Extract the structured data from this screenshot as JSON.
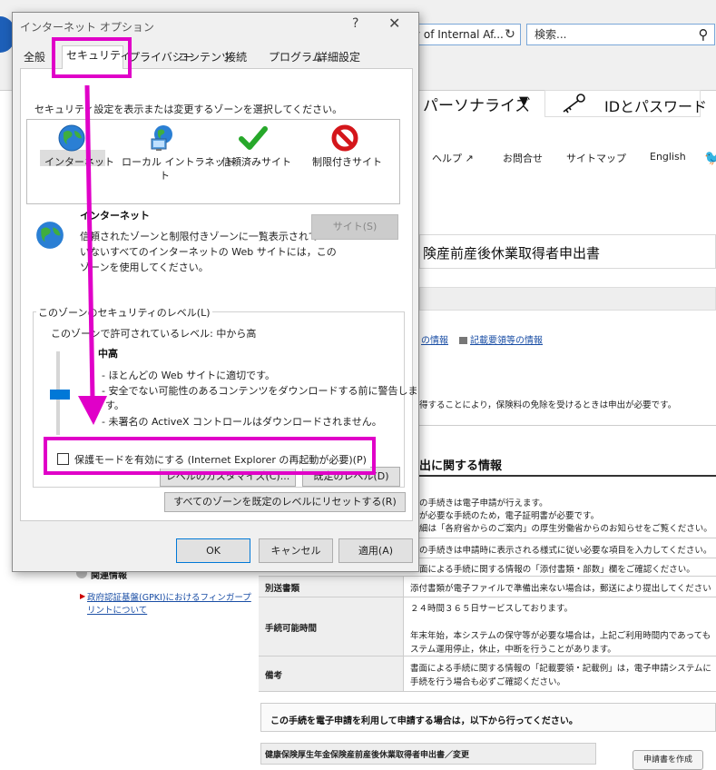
{
  "browser": {
    "address_text": "ry of Internal Af...",
    "search_placeholder": "検索...",
    "refresh_glyph": "↻",
    "search_glyph": "⚲"
  },
  "site": {
    "personalize": "パーソナライズ",
    "id_password": "IDとパスワード",
    "nav": [
      "ヘルプ",
      "お問合せ",
      "サイトマップ",
      "English"
    ],
    "page_title": "険産前産後休業取得者申出書",
    "links": [
      "の情報",
      "記載要領等の情報"
    ],
    "note1": "得することにより，保険料の免除を受けるときは申出が必要です。",
    "section_title": "出に関する情報",
    "info_lines": [
      "の手続きは電子申請が行えます。",
      "が必要な手続のため，電子証明書が必要です。",
      "細は「各府省からのご案内」の厚生労働省からのお知らせをご覧ください。",
      "の手続きは申請時に表示される様式に従い必要な項目を入力してください。",
      "面による手続に関する情報の「添付書類・部数」欄をご確認ください。"
    ],
    "table": [
      {
        "label": "別送書類",
        "value": [
          "添付書類が電子ファイルで準備出来ない場合は，郵送により提出してください"
        ]
      },
      {
        "label": "手続可能時間",
        "value": [
          "２４時間３６５日サービスしております。",
          "",
          "年末年始，本システムの保守等が必要な場合は，上記ご利用時間内であっても",
          "ステム運用停止，休止，中断を行うことがあります。"
        ]
      },
      {
        "label": "備考",
        "value": [
          "書面による手続に関する情報の「記載要領・記載例」は，電子申請システムに",
          "手続を行う場合も必ずご確認ください。"
        ]
      }
    ],
    "related_head": "関連情報",
    "related_links": [
      "政府認証基盤(GPKI)におけるフィンガープ",
      "リントについて"
    ],
    "apply_text": "この手続を電子申請を利用して申請する場合は，以下から行ってください。",
    "form_row_label": "健康保険厚生年金保険産前産後休業取得者申出書／変更",
    "create_button": "申請書を作成"
  },
  "dialog": {
    "title": "インターネット オプション",
    "help": "?",
    "close": "✕",
    "tabs": [
      "全般",
      "セキュリティ",
      "プライバシー",
      "コンテンツ",
      "接続",
      "プログラム",
      "詳細設定"
    ],
    "active_tab": "セキュリティ",
    "instruction": "セキュリティ設定を表示または変更するゾーンを選択してください。",
    "zones": [
      {
        "label": "インターネット",
        "icon": "globe-icon"
      },
      {
        "label": "ローカル イントラネット",
        "icon": "intranet-icon"
      },
      {
        "label": "信頼済みサイト",
        "icon": "checkmark-icon"
      },
      {
        "label": "制限付きサイト",
        "icon": "prohibited-icon"
      }
    ],
    "zone_label_wrap": "ト",
    "selected_zone_name": "インターネット",
    "zone_description": [
      "信頼されたゾーンと制限付きゾーンに一覧表示されて",
      "いないすべてのインターネットの Web サイトには，この",
      "ゾーンを使用してください。"
    ],
    "sites_button": "サイト(S)",
    "level_group_label": "このゾーンのセキュリティのレベル(L)",
    "allowed_levels": "このゾーンで許可されているレベル: 中から高",
    "level_name": "中高",
    "level_description": [
      "- ほとんどの Web サイトに適切です。",
      "- 安全でない可能性のあるコンテンツをダウンロードする前に警告しま",
      "す。",
      "- 未署名の ActiveX コントロールはダウンロードされません。"
    ],
    "protected_mode_label": "保護モードを有効にする (Internet Explorer の再起動が必要)(P)",
    "protected_mode_checked": false,
    "customize_button": "レベルのカスタマイズ(C)...",
    "default_level_button": "既定のレベル(D)",
    "reset_all_button": "すべてのゾーンを既定のレベルにリセットする(R)",
    "ok_button": "OK",
    "cancel_button": "キャンセル",
    "apply_button": "適用(A)"
  },
  "colors": {
    "annotation": "#e000c8",
    "accent": "#0078d7"
  }
}
